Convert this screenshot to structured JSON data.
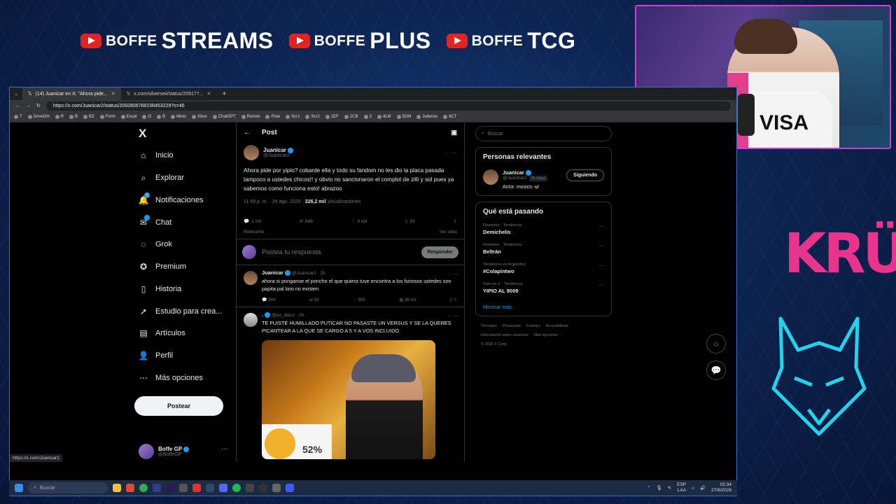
{
  "banner": {
    "items": [
      {
        "prefix": "BOFFE",
        "name": "STREAMS"
      },
      {
        "prefix": "BOFFE",
        "name": "PLUS"
      },
      {
        "prefix": "BOFFE",
        "name": "TCG"
      }
    ]
  },
  "overlay": {
    "logo_text": "KRÜ"
  },
  "browser": {
    "tabs": [
      {
        "label": "(14) Juanicar en X: \"Ahora pide...",
        "icon": "x-logo-icon"
      },
      {
        "label": "x.com/silverseii/status/209177...",
        "icon": "x-logo-icon"
      }
    ],
    "new_tab": "+",
    "url": "https://x.com/Juanicar2/status/2092806788156453229?s=46",
    "bookmarks": [
      "T",
      "DriveGH",
      "R",
      "B",
      "BZ",
      "Form",
      "Excel",
      "O",
      "B",
      "Minis",
      "Xbox",
      "ChatGPT",
      "Remini",
      "Flow",
      "Scr1",
      "Scr2",
      "1EF",
      "2CB",
      "3",
      "4LM",
      "5DM",
      "Julienzo",
      "6CT"
    ],
    "status_url": "https://x.com/Juanicar2"
  },
  "nav": {
    "logo": "X",
    "items": [
      {
        "label": "Inicio",
        "icon": "home-icon",
        "glyph": "⌂"
      },
      {
        "label": "Explorar",
        "icon": "search-icon",
        "glyph": "⌕"
      },
      {
        "label": "Notificaciones",
        "icon": "bell-icon",
        "glyph": "🔔"
      },
      {
        "label": "Chat",
        "icon": "chat-icon",
        "glyph": "✉"
      },
      {
        "label": "Grok",
        "icon": "grok-icon",
        "glyph": "◌"
      },
      {
        "label": "Premium",
        "icon": "premium-icon",
        "glyph": "✪"
      },
      {
        "label": "Historia",
        "icon": "bookmark-icon",
        "glyph": "▯"
      },
      {
        "label": "Estudio para crea...",
        "icon": "rocket-icon",
        "glyph": "➚"
      },
      {
        "label": "Artículos",
        "icon": "article-icon",
        "glyph": "▤"
      },
      {
        "label": "Perfil",
        "icon": "person-icon",
        "glyph": "👤"
      },
      {
        "label": "Más opciones",
        "icon": "more-icon",
        "glyph": "⋯"
      }
    ],
    "notification_badge": "2",
    "post_button": "Postear",
    "account": {
      "name": "Boffe GP",
      "handle": "@BoffeGP",
      "more": "···"
    }
  },
  "post": {
    "header": "Post",
    "author": {
      "name": "Juanicar",
      "handle": "@Juanicar2"
    },
    "text": "Ahora pide por yipio? cobarde ella y todo su fandom no les dio la placa pasada tampoco a ustedes chicos!! y obvio no sancionaron el complot de zilli y sol pues ya sabemos como funciona esto! abrazoo",
    "time": "11:49 p. m. · 26 ago. 2026 · ",
    "views": "226,2 mil",
    "views_label": " Visualizaciones",
    "stats": {
      "replies": "1 mil",
      "reposts": "846",
      "likes": "4 mil",
      "bookmarks": "93"
    },
    "relevance": "Relevante",
    "quotes": "Ver citas",
    "reply_placeholder": "Postea tu respuesta",
    "reply_button": "Responder"
  },
  "replies": [
    {
      "name": "Juanicar",
      "handle": "@Juanicar2 · 2h",
      "text": "ahora si ponganse el poncho el que quiera tuve encontra a los furiosos ustedes son papita pal loro no existen",
      "stats": {
        "replies": "344",
        "reposts": "80",
        "likes": "919",
        "views": "36 mil"
      }
    },
    {
      "name": ".",
      "handle": "@jor_daluz · 2h",
      "text": "TE FUISTE HUMILLADO PUTICAR NO PASASTE UN VERSUS Y SE LA QUERES PICANTEAR A LA QUE SE CARGO A 5 Y A VOS INCLUIDO",
      "media_text": "52%"
    }
  ],
  "sidebar": {
    "search_placeholder": "Buscar",
    "relevant": {
      "title": "Personas relevantes",
      "name": "Juanicar",
      "handle": "@Juanicar2",
      "follows_you": "Te sigue",
      "bio": "Actor. musico.🦋",
      "button": "Siguiendo"
    },
    "trends": {
      "title": "Qué está pasando",
      "items": [
        {
          "category": "Deportes · Tendencia",
          "topic": "Demichelis"
        },
        {
          "category": "Deportes · Tendencia",
          "topic": "Beltrán"
        },
        {
          "category": "Tendencia en Argentina",
          "topic": "#Colapintwo"
        },
        {
          "category": "Solo en X · Tendencia",
          "topic": "YIPIO AL 9009"
        }
      ],
      "show_more": "Mostrar más"
    },
    "footer": [
      "Términos",
      "Privacidad",
      "Cookies",
      "Accesibilidad",
      "Información sobre anuncios",
      "Más opciones ···",
      "© 2026 X Corp."
    ]
  },
  "taskbar": {
    "search": "Buscar",
    "lang": "ESP",
    "lang2": "LAA",
    "time": "02:34",
    "date": "27/8/2026"
  },
  "colors": {
    "accent": "#1d9bf0",
    "kru_pink": "#e8348d",
    "wolf_cyan": "#22d3ee",
    "yt_red": "#e02424"
  }
}
